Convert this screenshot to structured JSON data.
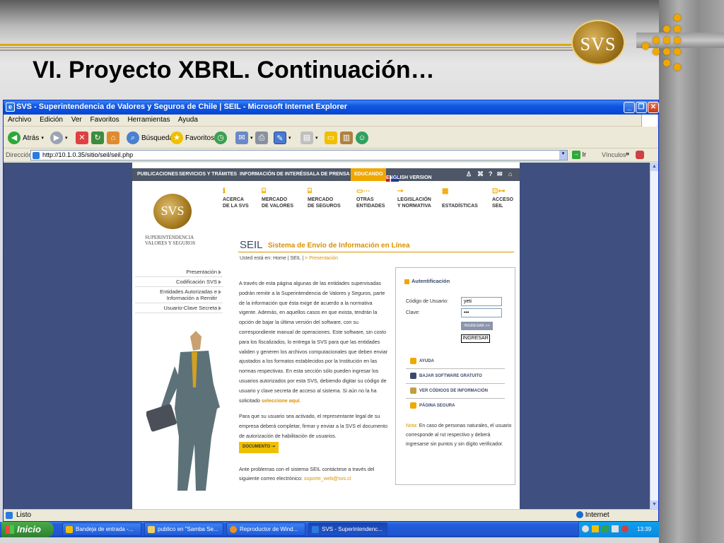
{
  "slide": {
    "title": "VI. Proyecto XBRL. Continuación…",
    "logo_text": "SVS"
  },
  "window": {
    "title": "SVS - Superintendencia de Valores y Seguros de Chile | SEIL - Microsoft Internet Explorer",
    "menu": [
      "Archivo",
      "Edición",
      "Ver",
      "Favoritos",
      "Herramientas",
      "Ayuda"
    ],
    "toolbar": {
      "back": "Atrás",
      "search": "Búsqueda",
      "favorites": "Favoritos"
    },
    "address": {
      "label": "Dirección",
      "url": "http://10.1.0.35/sitio/seil/seil.php",
      "go": "Ir",
      "links": "Vínculos"
    },
    "status": "Listo",
    "zone": "Internet"
  },
  "page": {
    "topnav": [
      "PUBLICACIONES",
      "SERVICIOS Y TRÁMITES",
      "INFORMACIÓN DE INTERÉS",
      "SALA DE PRENSA",
      "EDUCANDO",
      "ENGLISH VERSION"
    ],
    "logo_text": "SVS",
    "brand": [
      "SUPERINTENDENCIA",
      "VALORES Y SEGUROS"
    ],
    "mainmenu": [
      [
        "ACERCA",
        "DE LA SVS"
      ],
      [
        "MERCADO",
        "DE VALORES"
      ],
      [
        "MERCADO",
        "DE SEGUROS"
      ],
      [
        "OTRAS",
        "ENTIDADES"
      ],
      [
        "LEGISLACIÓN",
        "Y NORMATIVA"
      ],
      [
        "",
        "ESTADÍSTICAS"
      ],
      [
        "ACCESO",
        "SEIL"
      ]
    ],
    "seil_title": "SEIL",
    "seil_subtitle": "Sistema de Envío de Información en Línea",
    "breadcrumb": {
      "prefix": "Usted está en: Home | SEIL |",
      "current": "> Presentación"
    },
    "sidemenu": [
      "Presentación",
      "Codificación SVS",
      "Entidades Autorizadas e Información a Remitir",
      "Usuario-Clave Secreta"
    ],
    "body": {
      "p1": "A través de esta página algunas de las entidades supervisadas podrán remitir a la Superintendencia de Valores y Seguros, parte de la información que ésta exige de acuerdo a la normativa vigente. Además, en aquellos casos en que exista, tendrán la opción de bajar la última versión del software, con su correspondiente manual de operaciones. Este software, sin costo para los fiscalizados, lo entrega la SVS para que las entidades validen y generen los archivos computacionales que deben enviar ajustados a los formatos establecidos por la Institución en las normas respectivas. En esta sección sólo pueden ingresar los usuarios autorizados por esta SVS, debiendo digitar su código de usuario y clave secreta de acceso al sistema. Si aún no la ha solicitado",
      "p1_link": "seleccione aquí",
      "p2": "Para que su usuario sea activado, el representante legal de su empresa deberá completar, firmar y enviar a la SVS el documento de autorización de habilitación de usuarios.",
      "doc_button": "DOCUMENTO",
      "p3": "Ante problemas con el sistema SEIL contáctese a través del siguiente correo electrónico:",
      "email": "soporte_web@svs.cl"
    },
    "auth": {
      "title": "Autentificación",
      "user_label": "Código de Usuario:",
      "user_value": "yeti",
      "pass_label": "Clave:",
      "pass_value": "•••",
      "btn1": "INGRESAR >>",
      "btn2": "INGRESAR",
      "links": [
        "AYUDA",
        "BAJAR SOFTWARE GRATUITO",
        "VER CÓDIGOS DE INFORMACIÓN",
        "PÁGINA SEGURA"
      ],
      "note_label": "Nota:",
      "note": "En caso de personas naturales, el usuario corresponde al rut respectivo y deberá ingresarse sin puntos y sin dígito verificador."
    }
  },
  "taskbar": {
    "start": "Inicio",
    "tasks": [
      "Bandeja de entrada -...",
      "publico en \"Samba Se...",
      "Reproductor de Wind...",
      "SVS - Superintendenc..."
    ],
    "clock": "13:39"
  }
}
